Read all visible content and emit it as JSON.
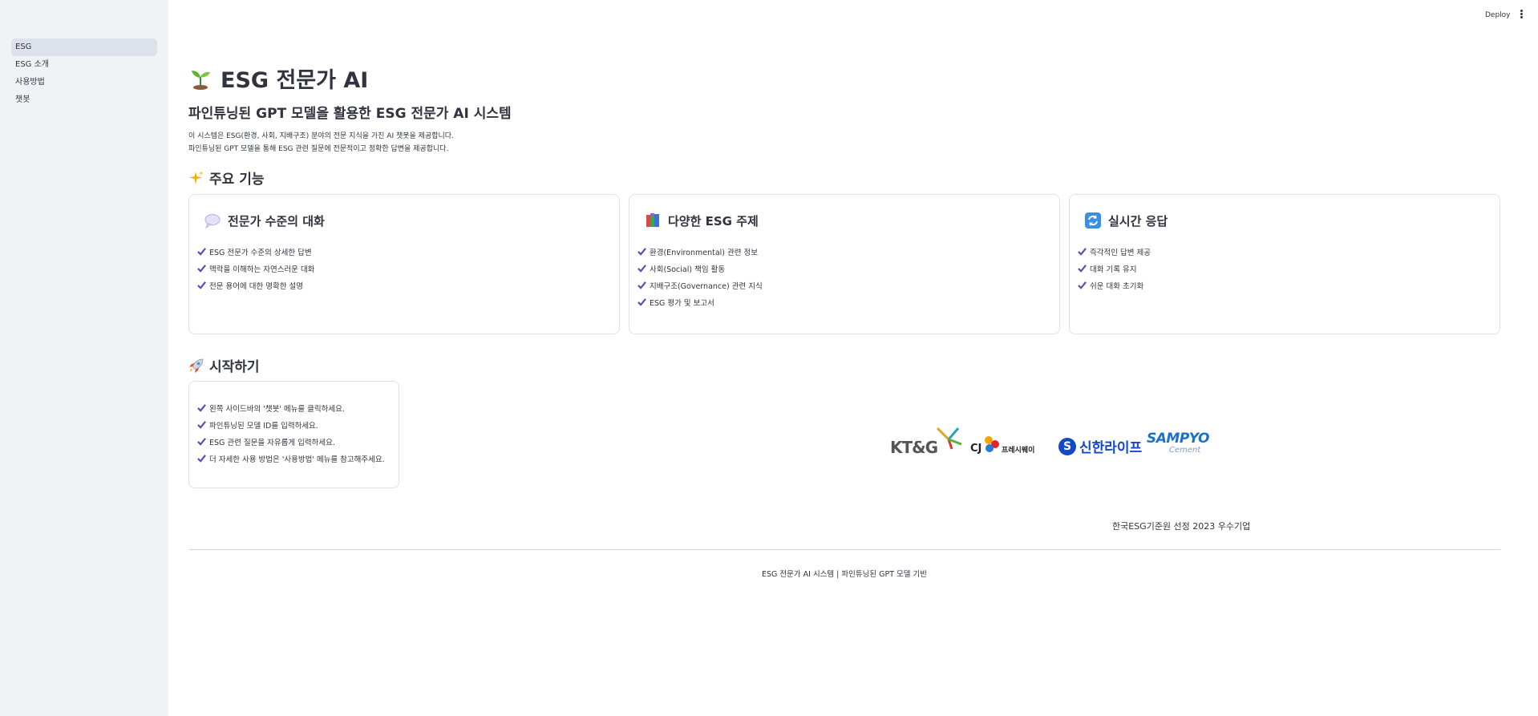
{
  "topbar": {
    "deploy_label": "Deploy"
  },
  "sidebar": {
    "items": [
      {
        "label": "ESG",
        "active": true
      },
      {
        "label": "ESG 소개",
        "active": false
      },
      {
        "label": "사용방법",
        "active": false
      },
      {
        "label": "챗봇",
        "active": false
      }
    ]
  },
  "header": {
    "title_icon": "seedling-icon",
    "title": "ESG 전문가 AI",
    "subtitle": "파인튜닝된 GPT 모델을 활용한 ESG 전문가 AI 시스템",
    "desc_line1": "이 시스템은 ESG(환경, 사회, 지배구조) 분야의 전문 지식을 가진 AI 챗봇을 제공합니다.",
    "desc_line2": "파인튜닝된 GPT 모델을 통해 ESG 관련 질문에 전문적이고 정확한 답변을 제공합니다."
  },
  "features": {
    "heading_icon": "sparkles-icon",
    "heading": "주요 기능",
    "cards": [
      {
        "icon": "speech-bubble-icon",
        "title": "전문가 수준의 대화",
        "items": [
          "ESG 전문가 수준의 상세한 답변",
          "맥락을 이해하는 자연스러운 대화",
          "전문 용어에 대한 명확한 설명"
        ]
      },
      {
        "icon": "books-icon",
        "title": "다양한 ESG 주제",
        "items": [
          "환경(Environmental) 관련 정보",
          "사회(Social) 책임 활동",
          "지배구조(Governance) 관련 지식",
          "ESG 평가 및 보고서"
        ]
      },
      {
        "icon": "refresh-icon",
        "title": "실시간 응답",
        "items": [
          "즉각적인 답변 제공",
          "대화 기록 유지",
          "쉬운 대화 초기화"
        ]
      }
    ]
  },
  "getting_started": {
    "heading_icon": "rocket-icon",
    "heading": "시작하기",
    "items": [
      "왼쪽 사이드바의 '챗봇' 메뉴를 클릭하세요.",
      "파인튜닝된 모델 ID를 입력하세요.",
      "ESG 관련 질문을 자유롭게 입력하세요.",
      "더 자세한 사용 방법은 '사용방법' 메뉴를 참고해주세요."
    ]
  },
  "logos": {
    "ktng": "KT&G",
    "cj_mark": "CJ",
    "cj_text": "프레시웨이",
    "shinhan_mark": "S",
    "shinhan_text": "신한라이프",
    "sampyo_main": "SAMPYO",
    "sampyo_sub": "Cement",
    "caption": "한국ESG기준원 선정 2023 우수기업"
  },
  "footer": {
    "text": "ESG 전문가 AI 시스템 | 파인튜닝된 GPT 모델 기반"
  },
  "colors": {
    "check": "#5c4db1",
    "sidebar_bg": "#f0f2f6",
    "active_nav": "#dde1ea",
    "border": "#e0e2e8"
  }
}
